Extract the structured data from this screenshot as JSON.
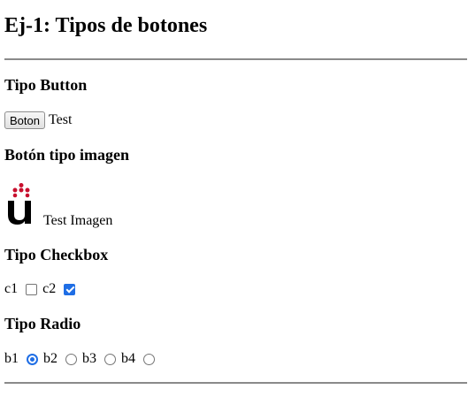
{
  "title": "Ej-1: Tipos de botones",
  "sections": {
    "button": {
      "heading": "Tipo Button",
      "button_label": "Boton",
      "text": "Test"
    },
    "image": {
      "heading": "Botón tipo imagen",
      "image_icon": "university-logo-icon",
      "text": "Test Imagen",
      "logo_color": "#c8102e"
    },
    "checkbox": {
      "heading": "Tipo Checkbox",
      "items": [
        {
          "label": "c1",
          "checked": false
        },
        {
          "label": "c2",
          "checked": true
        }
      ]
    },
    "radio": {
      "heading": "Tipo Radio",
      "items": [
        {
          "label": "b1",
          "checked": true
        },
        {
          "label": "b2",
          "checked": false
        },
        {
          "label": "b3",
          "checked": false
        },
        {
          "label": "b4",
          "checked": false
        }
      ]
    }
  },
  "colors": {
    "accent": "#1f6ee5",
    "rule": "#8a8a8a"
  }
}
